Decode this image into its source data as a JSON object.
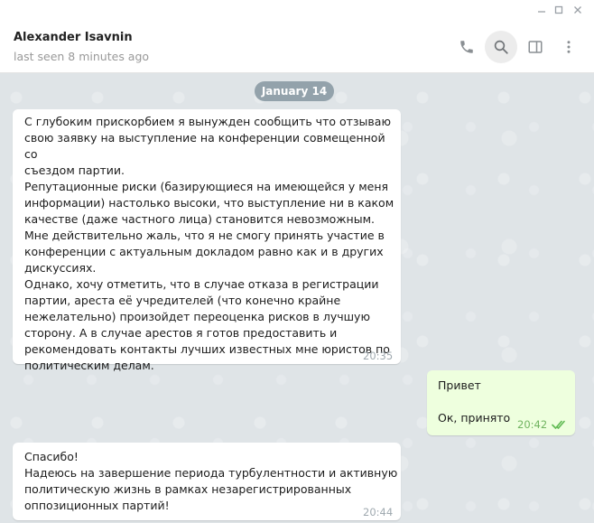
{
  "window": {
    "controls": [
      "minimize",
      "maximize",
      "close"
    ]
  },
  "header": {
    "contact_name": "Alexander Isavnin",
    "status": "last seen 8 minutes ago",
    "icons": [
      "phone-icon",
      "search-icon",
      "sidebar-toggle-icon",
      "more-vertical-icon"
    ]
  },
  "chat": {
    "date_label": "January 14",
    "messages": [
      {
        "direction": "incoming",
        "text": "С глубоким прискорбием я вынужден сообщить что отзываю\nсвою заявку на выступление на конференции совмещенной со\nсъездом партии.\nРепутационные риски (базирующиеся на имеющейся у меня\nинформации) настолько высоки, что выступление ни в каком\nкачестве (даже частного лица) становится невозможным.\nМне действительно жаль, что я не смогу принять участие в\nконференции с актуальным докладом равно как и в других\nдискуссиях.\nОднако, хочу отметить, что в случае отказа в регистрации\nпартии, ареста её учредителей (что конечно крайне\nнежелательно) произойдет переоценка рисков в лучшую\nсторону. А в случае арестов я готов предоставить и\nрекомендовать контакты лучших известных мне юристов по\nполитическим делам.",
        "time": "20:35"
      },
      {
        "direction": "outgoing",
        "text": "Привет\n\nОк, принято",
        "time": "20:42",
        "status": "read"
      },
      {
        "direction": "incoming",
        "text": "Спасибо!\nНадеюсь на завершение периода турбулентности и активную\nполитическую жизнь в рамках незарегистрированных\nоппозиционных партий!",
        "time": "20:44"
      }
    ]
  },
  "colors": {
    "chat_background": "#dfe4e7",
    "incoming_bubble": "#ffffff",
    "outgoing_bubble": "#eeffde",
    "date_pill": "#93a2ab",
    "read_checks": "#5fba52"
  }
}
